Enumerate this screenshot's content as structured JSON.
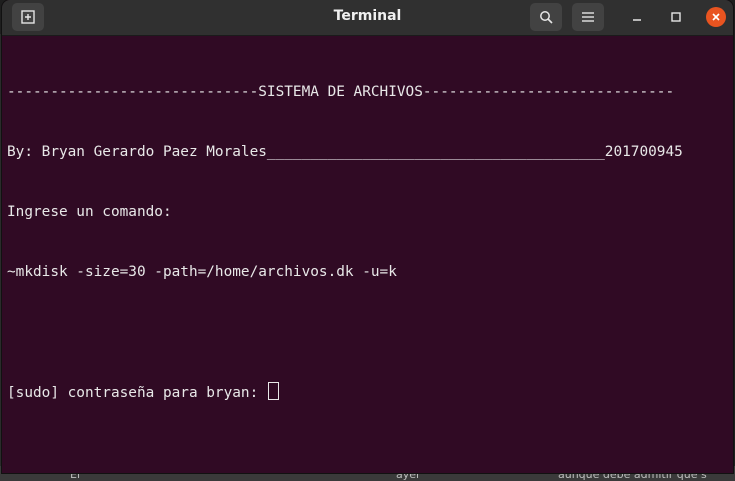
{
  "window": {
    "title": "Terminal",
    "icons": {
      "new_tab": "new-tab-icon",
      "search": "search-icon",
      "menu": "hamburger-menu-icon",
      "minimize": "minimize-icon",
      "maximize": "maximize-icon",
      "close": "close-icon"
    },
    "colors": {
      "terminal_bg": "#300a24",
      "titlebar_bg": "#303030",
      "close_button": "#e95420",
      "text": "#e8e8e8"
    }
  },
  "terminal": {
    "lines": [
      "-----------------------------SISTEMA DE ARCHIVOS-----------------------------",
      "By: Bryan Gerardo Paez Morales_______________________________________201700945",
      "Ingrese un comando:",
      "~mkdisk -size=30 -path=/home/archivos.dk -u=k",
      "",
      "[sudo] contraseña para bryan: "
    ]
  },
  "background": {
    "fragment_1": "El",
    "fragment_2": "ayer",
    "fragment_3": "aunque debe admitir que s"
  }
}
